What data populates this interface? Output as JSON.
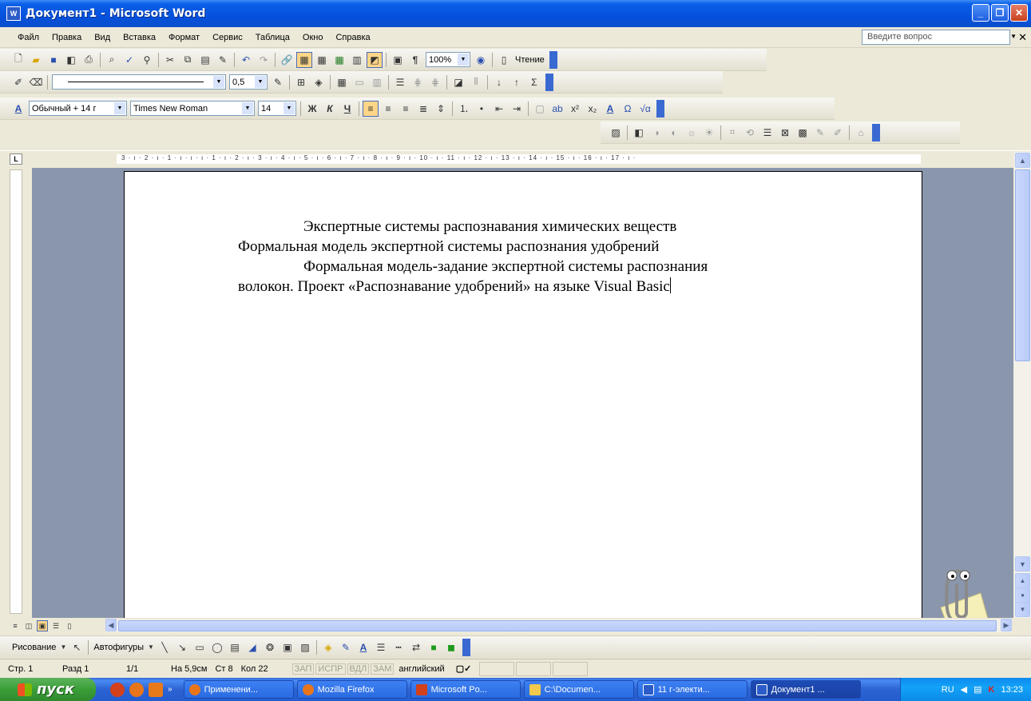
{
  "window": {
    "title": "Документ1 - Microsoft Word",
    "app_icon": "W"
  },
  "menubar": {
    "items": [
      "Файл",
      "Правка",
      "Вид",
      "Вставка",
      "Формат",
      "Сервис",
      "Таблица",
      "Окно",
      "Справка"
    ],
    "help_placeholder": "Введите вопрос"
  },
  "standard_toolbar": {
    "zoom": "100%",
    "reading_label": "Чтение"
  },
  "tables_toolbar": {
    "line_weight": "0,5"
  },
  "format_toolbar": {
    "style": "Обычный + 14 г",
    "font": "Times New Roman",
    "size": "14",
    "bold": "Ж",
    "italic": "К",
    "underline": "Ч"
  },
  "ruler": {
    "corner": "L",
    "marks": "3 · ı · 2 · ı · 1 · ı · ı · ı · 1 · ı · 2 · ı · 3 · ı · 4 · ı · 5 · ı · 6 · ı · 7 · ı · 8 · ı · 9 · ı · 10 · ı · 11 · ı · 12 · ı · 13 · ı · 14 · ı · 15 · ı · 16 · ı · 17 · ı ·"
  },
  "document": {
    "paragraphs": [
      {
        "first": "Экспертные системы распознавания химических",
        "rest": "веществ Формальная модель экспертной системы распознания удобрений"
      },
      {
        "first": "Формальная модель-задание экспертной системы",
        "rest": "распознания волокон. Проект «Распознавание удобрений» на языке Visual Basic"
      }
    ]
  },
  "drawing_toolbar": {
    "draw_label": "Рисование",
    "autoshapes_label": "Автофигуры"
  },
  "statusbar": {
    "page": "Стр. 1",
    "section": "Разд 1",
    "pages": "1/1",
    "at": "На 5,9см",
    "line": "Ст 8",
    "col": "Кол 22",
    "rec": "ЗАП",
    "trk": "ИСПР",
    "ext": "ВДЛ",
    "ovr": "ЗАМ",
    "language": "английский"
  },
  "taskbar": {
    "start_label": "пуск",
    "buttons": [
      {
        "label": "Применени...",
        "active": false
      },
      {
        "label": "Mozilla Firefox",
        "active": false
      },
      {
        "label": "Microsoft Po...",
        "active": false
      },
      {
        "label": "C:\\Documen...",
        "active": false
      },
      {
        "label": "11 г-электи...",
        "active": false
      },
      {
        "label": "Документ1 ...",
        "active": true
      }
    ],
    "lang": "RU",
    "clock": "13:23"
  },
  "colors": {
    "titlebar": "#0551DD",
    "doc_background": "#8A96AC",
    "taskbar": "#2D63D2",
    "start_button": "#3A9E38"
  }
}
